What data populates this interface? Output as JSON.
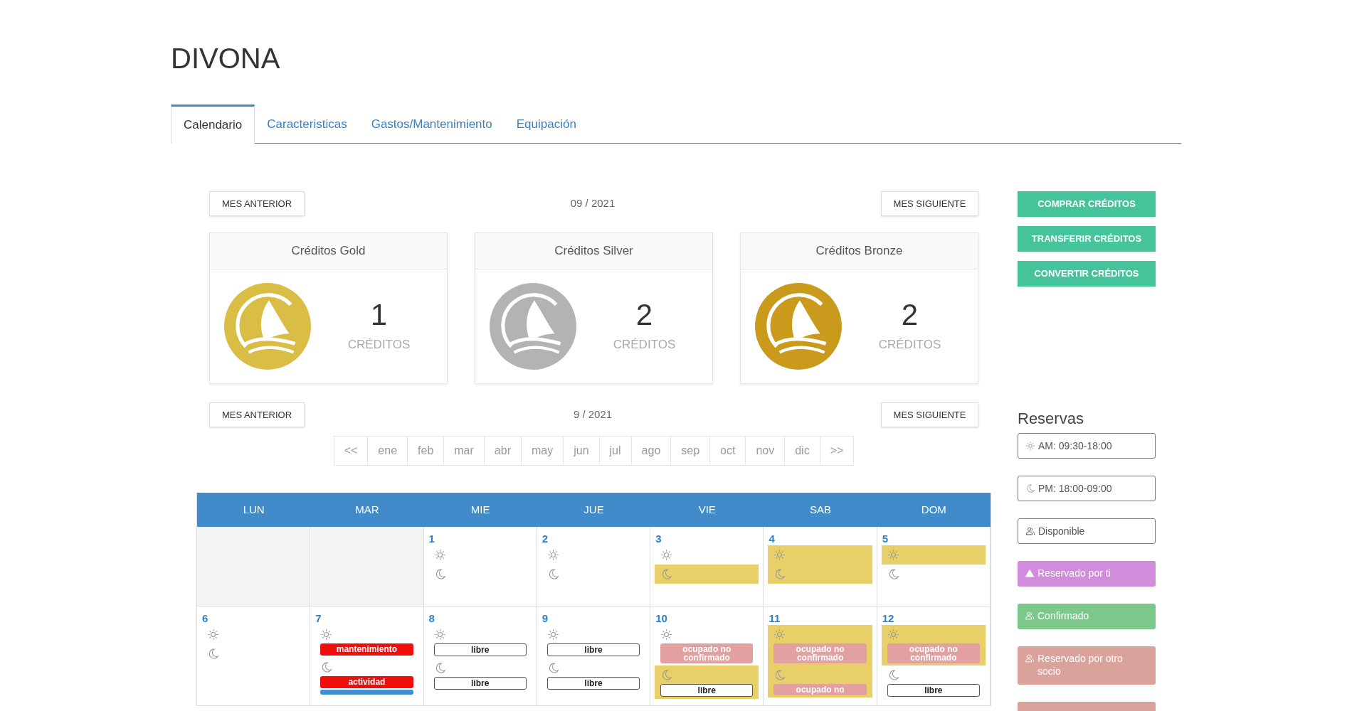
{
  "title": "DIVONA",
  "tabs": [
    {
      "label": "Calendario",
      "selected": true
    },
    {
      "label": "Caracteristicas",
      "selected": false
    },
    {
      "label": "Gastos/Mantenimiento",
      "selected": false
    },
    {
      "label": "Equipación",
      "selected": false
    }
  ],
  "top_nav": {
    "prev": "MES ANTERIOR",
    "period": "09 / 2021",
    "next": "MES SIGUIENTE"
  },
  "credit_cards": [
    {
      "title": "Créditos Gold",
      "color": "#d9bd45",
      "amount": "1",
      "unit": "CRÉDITOS"
    },
    {
      "title": "Créditos Silver",
      "color": "#b3b3b3",
      "amount": "2",
      "unit": "CRÉDITOS"
    },
    {
      "title": "Créditos Bronze",
      "color": "#c99a1c",
      "amount": "2",
      "unit": "CRÉDITOS"
    }
  ],
  "calendar_nav": {
    "prev": "MES ANTERIOR",
    "period": "9 / 2021",
    "next": "MES SIGUIENTE"
  },
  "months": [
    "<<",
    "ene",
    "feb",
    "mar",
    "abr",
    "may",
    "jun",
    "jul",
    "ago",
    "sep",
    "oct",
    "nov",
    "dic",
    ">>"
  ],
  "calendar": {
    "weekdays": [
      "LUN",
      "MAR",
      "MIE",
      "JUE",
      "VIE",
      "SAB",
      "DOM"
    ],
    "weeks": [
      [
        {
          "kind": "blank"
        },
        {
          "kind": "blank"
        },
        {
          "kind": "day",
          "number": "1",
          "am": {
            "highlighted": false
          },
          "pm": {
            "highlighted": false
          }
        },
        {
          "kind": "day",
          "number": "2",
          "am": {
            "highlighted": false
          },
          "pm": {
            "highlighted": false
          }
        },
        {
          "kind": "day",
          "number": "3",
          "am": {
            "highlighted": false
          },
          "pm": {
            "highlighted": true
          }
        },
        {
          "kind": "day",
          "number": "4",
          "am": {
            "highlighted": true
          },
          "pm": {
            "highlighted": true
          }
        },
        {
          "kind": "day",
          "number": "5",
          "am": {
            "highlighted": true
          },
          "pm": {
            "highlighted": false
          }
        }
      ],
      [
        {
          "kind": "day",
          "number": "6",
          "am": {
            "highlighted": false
          },
          "pm": {
            "highlighted": false
          }
        },
        {
          "kind": "day",
          "number": "7",
          "am": {
            "highlighted": false,
            "tags": [
              {
                "kind": "maintenance",
                "label": "mantenimiento"
              }
            ]
          },
          "pm": {
            "highlighted": false,
            "tags": [
              {
                "kind": "activity",
                "label": "actividad"
              },
              {
                "kind": "info"
              }
            ]
          }
        },
        {
          "kind": "day",
          "number": "8",
          "am": {
            "highlighted": false,
            "tags": [
              {
                "kind": "free",
                "label": "libre"
              }
            ]
          },
          "pm": {
            "highlighted": false,
            "tags": [
              {
                "kind": "free",
                "label": "libre"
              }
            ]
          }
        },
        {
          "kind": "day",
          "number": "9",
          "am": {
            "highlighted": false,
            "tags": [
              {
                "kind": "free",
                "label": "libre"
              }
            ]
          },
          "pm": {
            "highlighted": false,
            "tags": [
              {
                "kind": "free",
                "label": "libre"
              }
            ]
          }
        },
        {
          "kind": "day",
          "number": "10",
          "am": {
            "highlighted": false,
            "tags": [
              {
                "kind": "pending",
                "label": "ocupado no confirmado"
              }
            ]
          },
          "pm": {
            "highlighted": true,
            "tags": [
              {
                "kind": "free",
                "label": "libre"
              }
            ]
          }
        },
        {
          "kind": "day",
          "number": "11",
          "am": {
            "highlighted": true,
            "tags": [
              {
                "kind": "pending",
                "label": "ocupado no confirmado"
              }
            ]
          },
          "pm": {
            "highlighted": true,
            "tags": [
              {
                "kind": "pending",
                "label": "ocupado no"
              }
            ]
          }
        },
        {
          "kind": "day",
          "number": "12",
          "am": {
            "highlighted": true,
            "tags": [
              {
                "kind": "pending",
                "label": "ocupado no confirmado"
              }
            ]
          },
          "pm": {
            "highlighted": false,
            "tags": [
              {
                "kind": "free",
                "label": "libre"
              }
            ]
          }
        }
      ]
    ]
  },
  "actions": [
    "COMPRAR CRÉDITOS",
    "TRANSFERIR CRÉDITOS",
    "CONVERTIR CRÉDITOS"
  ],
  "legend": {
    "title": "Reservas",
    "items": [
      {
        "kind": "am",
        "label": "AM: 09:30-18:00"
      },
      {
        "kind": "pm",
        "label": "PM: 18:00-09:00"
      },
      {
        "kind": "available",
        "label": "Disponible"
      },
      {
        "kind": "mine",
        "label": "Reservado por ti",
        "color": "#cf8ddb"
      },
      {
        "kind": "confirmed",
        "label": "Confirmado",
        "color": "#7cc88a"
      },
      {
        "kind": "other",
        "label": "Reservado por otro socio",
        "color": "#d9a39b"
      },
      {
        "kind": "partial",
        "color": "#d9a39b"
      }
    ]
  }
}
